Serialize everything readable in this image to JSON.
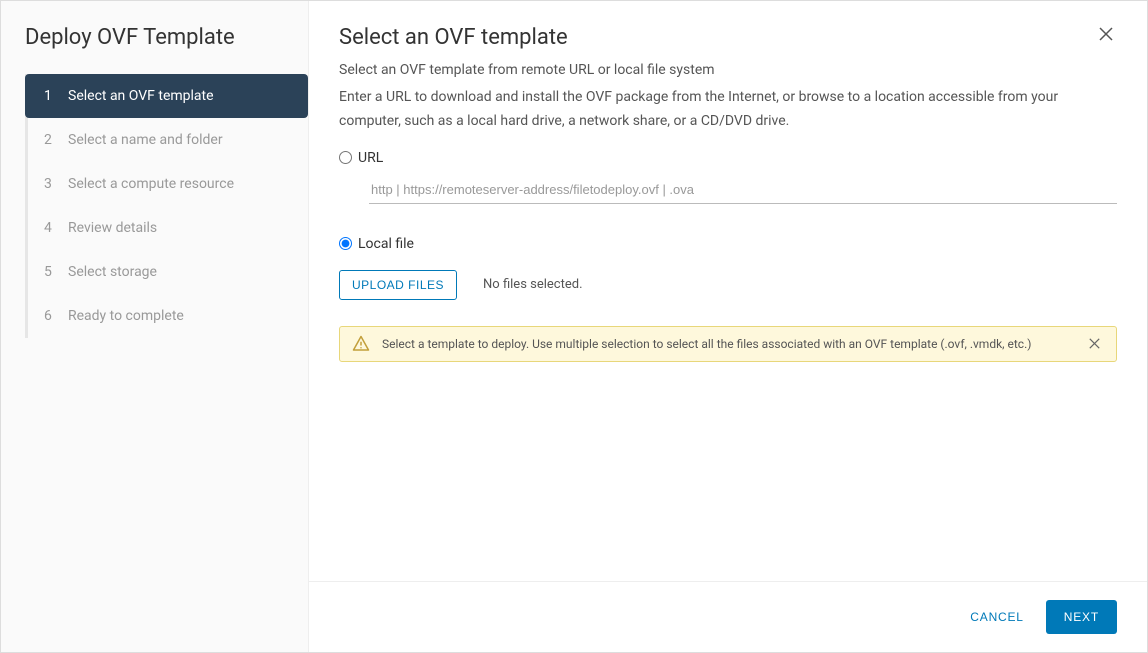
{
  "sidebar": {
    "title": "Deploy OVF Template",
    "steps": [
      {
        "num": "1",
        "label": "Select an OVF template",
        "active": true
      },
      {
        "num": "2",
        "label": "Select a name and folder",
        "active": false
      },
      {
        "num": "3",
        "label": "Select a compute resource",
        "active": false
      },
      {
        "num": "4",
        "label": "Review details",
        "active": false
      },
      {
        "num": "5",
        "label": "Select storage",
        "active": false
      },
      {
        "num": "6",
        "label": "Ready to complete",
        "active": false
      }
    ]
  },
  "main": {
    "title": "Select an OVF template",
    "subtitle": "Select an OVF template from remote URL or local file system",
    "description": "Enter a URL to download and install the OVF package from the Internet, or browse to a location accessible from your computer, such as a local hard drive, a network share, or a CD/DVD drive.",
    "url_label": "URL",
    "url_placeholder": "http | https://remoteserver-address/filetodeploy.ovf | .ova",
    "local_label": "Local file",
    "upload_button": "UPLOAD FILES",
    "no_files_text": "No files selected.",
    "notice_text": "Select a template to deploy. Use multiple selection to select all the files associated with an OVF template (.ovf, .vmdk, etc.)"
  },
  "footer": {
    "cancel": "CANCEL",
    "next": "NEXT"
  }
}
